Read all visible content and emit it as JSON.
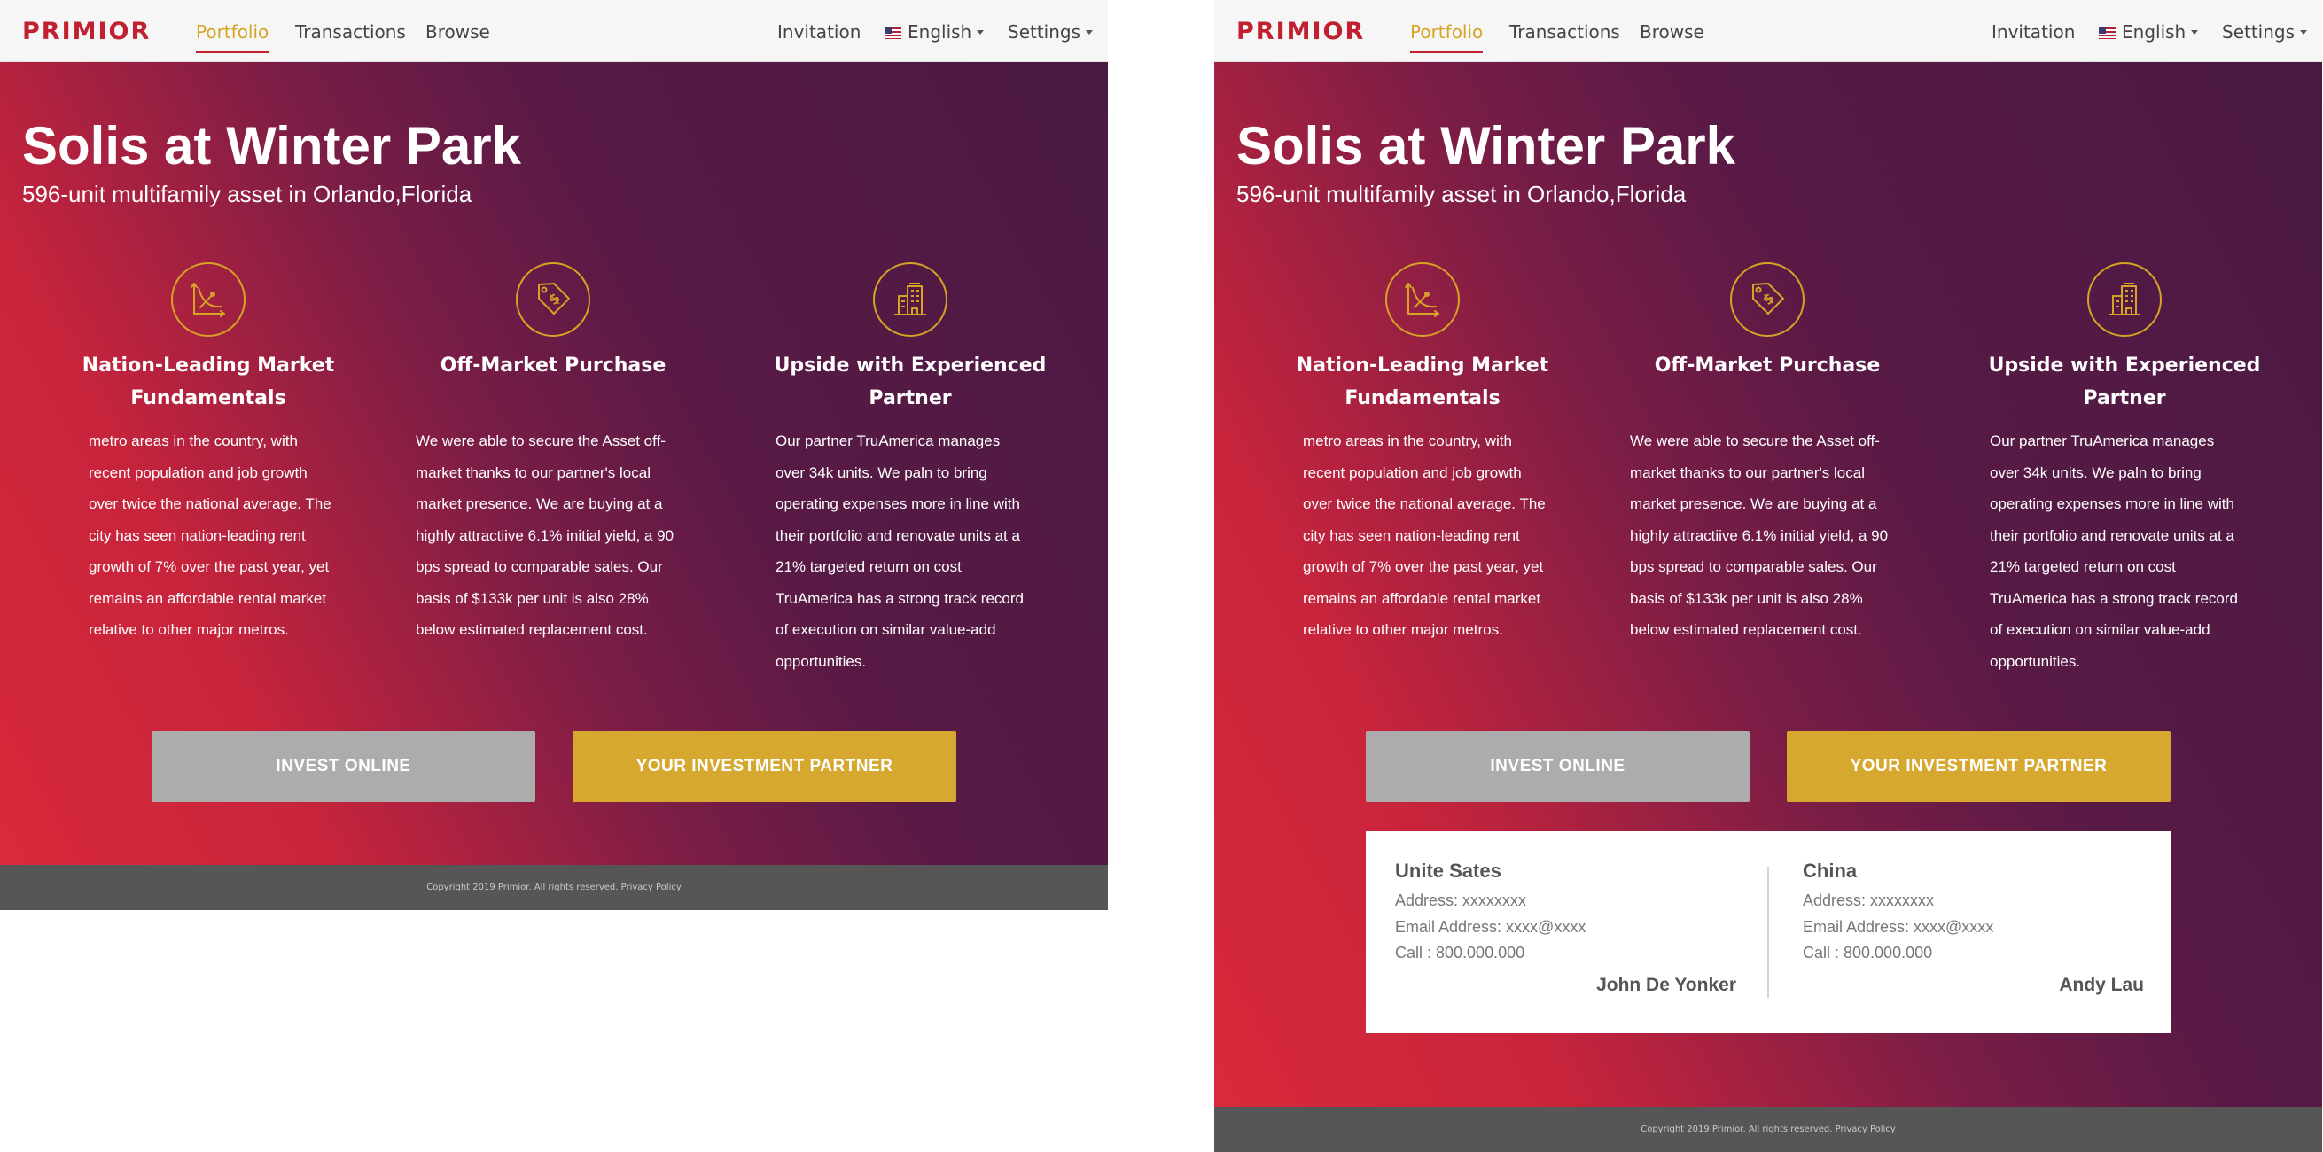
{
  "nav": {
    "logo": "PRIMIOR",
    "portfolio": "Portfolio",
    "transactions": "Transactions",
    "browse": "Browse",
    "invitation": "Invitation",
    "language": "English",
    "settings": "Settings"
  },
  "hero": {
    "title": "Solis at Winter Park",
    "subtitle": "596-unit multifamily asset in Orlando,Florida"
  },
  "features": [
    {
      "icon": "chart-icon",
      "title": "Nation-Leading Market Fundamentals",
      "lines": [
        "metro areas in the country, with",
        "recent population and job growth",
        "over twice the national average. The",
        "city has seen nation-leading rent",
        "growth of 7% over the past year, yet",
        "remains an affordable rental market",
        "relative to other major metros."
      ]
    },
    {
      "icon": "price-tag-icon",
      "title": "Off-Market Purchase",
      "lines": [
        "We were able to secure the Asset off-",
        "market thanks to our partner's local",
        "market presence. We are buying at a",
        "highly attractiive 6.1% initial yield, a 90",
        "bps spread to comparable sales. Our",
        "basis of $133k per unit is also 28%",
        "below estimated replacement cost."
      ]
    },
    {
      "icon": "building-icon",
      "title": "Upside with Experienced Partner",
      "lines": [
        "Our partner TruAmerica manages",
        "over 34k units. We paln to bring",
        "operating expenses more in line with",
        "their portfolio and renovate units at a",
        "21% targeted return on cost",
        "TruAmerica has a strong track record",
        "of execution on similar value-add",
        "opportunities."
      ]
    }
  ],
  "buttons": {
    "invest": "INVEST ONLINE",
    "partner": "YOUR INVESTMENT PARTNER"
  },
  "contacts": [
    {
      "country": "Unite Sates",
      "address": "Address: xxxxxxxx",
      "email": "Email Address: xxxx@xxxx",
      "call": "Call : 800.000.000",
      "name": "John De Yonker"
    },
    {
      "country": "China",
      "address": "Address: xxxxxxxx",
      "email": "Email Address: xxxx@xxxx",
      "call": "Call : 800.000.000",
      "name": "Andy Lau"
    }
  ],
  "footer": {
    "copyright": "Copyright 2019 Primior. All rights reserved.",
    "privacy": "Privacy Policy"
  },
  "colors": {
    "brand": "#c0202f",
    "accent": "#d6a324",
    "gradient_start": "#d82a3a",
    "gradient_end": "#4a1943",
    "footer": "#565656"
  }
}
